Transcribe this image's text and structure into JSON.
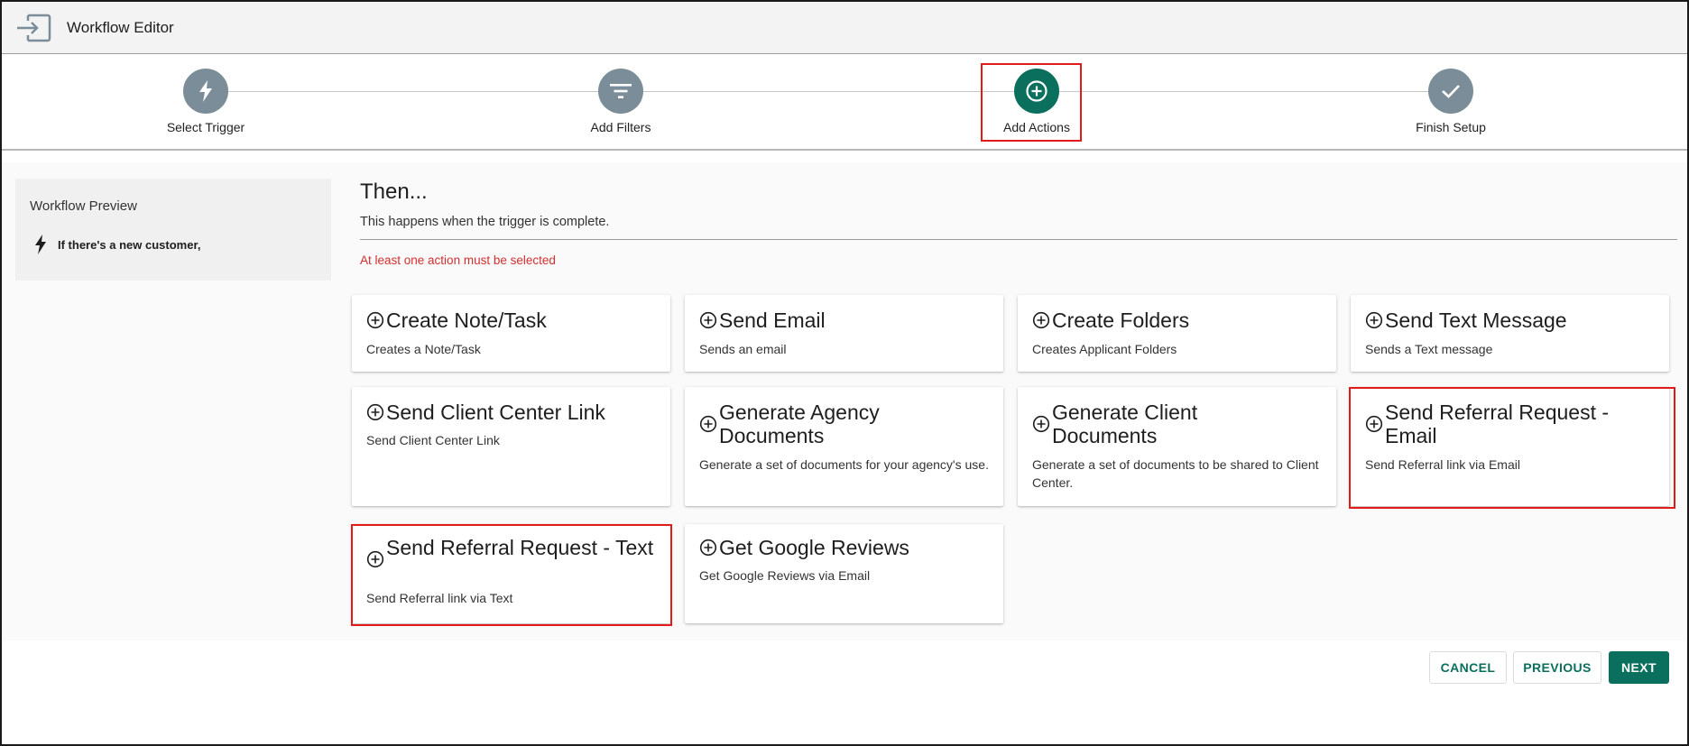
{
  "header": {
    "title": "Workflow Editor",
    "exit_icon": "exit-to-app-icon"
  },
  "stepper": {
    "steps": [
      {
        "label": "Select Trigger",
        "icon": "lightning-bolt-icon",
        "state": "done"
      },
      {
        "label": "Add Filters",
        "icon": "filter-icon",
        "state": "done"
      },
      {
        "label": "Add Actions",
        "icon": "add-circle-icon",
        "state": "active"
      },
      {
        "label": "Finish Setup",
        "icon": "check-icon",
        "state": "pending"
      }
    ]
  },
  "preview": {
    "title": "Workflow Preview",
    "trigger_text": "If there's a new customer,"
  },
  "main": {
    "heading": "Then...",
    "subheading": "This happens when the trigger is complete.",
    "error": "At least one action must be selected"
  },
  "actions": [
    {
      "title": "Create Note/Task",
      "desc": "Creates a Note/Task"
    },
    {
      "title": "Send Email",
      "desc": "Sends an email"
    },
    {
      "title": "Create Folders",
      "desc": "Creates Applicant Folders"
    },
    {
      "title": "Send Text Message",
      "desc": "Sends a Text message"
    },
    {
      "title": "Send Client Center Link",
      "desc": "Send Client Center Link"
    },
    {
      "title": "Generate Agency Documents",
      "desc": "Generate a set of documents for your agency's use."
    },
    {
      "title": "Generate Client Documents",
      "desc": "Generate a set of documents to be shared to Client Center."
    },
    {
      "title": "Send Referral Request - Email",
      "desc": "Send Referral link via Email"
    },
    {
      "title": "Send Referral Request - Text",
      "desc": "Send Referral link via Text"
    },
    {
      "title": "Get Google Reviews",
      "desc": "Get Google Reviews via Email"
    }
  ],
  "buttons": {
    "cancel": "CANCEL",
    "previous": "PREVIOUS",
    "next": "NEXT"
  },
  "colors": {
    "accent": "#0b6f5e",
    "step_inactive": "#7b8d98",
    "error": "#d32f2f",
    "highlight": "#e11a1a"
  }
}
